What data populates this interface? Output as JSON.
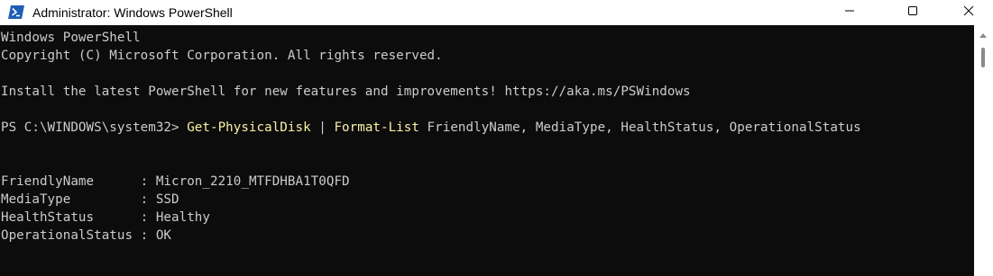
{
  "window": {
    "title": "Administrator: Windows PowerShell",
    "app_icon": "powershell-icon",
    "controls": {
      "minimize_icon": "minimize-icon",
      "maximize_icon": "maximize-icon",
      "close_icon": "close-icon"
    }
  },
  "console": {
    "header_line1": "Windows PowerShell",
    "header_line2": "Copyright (C) Microsoft Corporation. All rights reserved.",
    "install_line": "Install the latest PowerShell for new features and improvements! https://aka.ms/PSWindows",
    "prompt": "PS C:\\WINDOWS\\system32> ",
    "command": {
      "cmdlet1": "Get-PhysicalDisk",
      "pipe": " | ",
      "cmdlet2": "Format-List",
      "args": " FriendlyName, MediaType, HealthStatus, OperationalStatus"
    },
    "output": [
      {
        "key": "FriendlyName      : ",
        "value": "Micron_2210_MTFDHBA1T0QFD"
      },
      {
        "key": "MediaType         : ",
        "value": "SSD"
      },
      {
        "key": "HealthStatus      : ",
        "value": "Healthy"
      },
      {
        "key": "OperationalStatus : ",
        "value": "OK"
      }
    ]
  },
  "colors": {
    "background": "#0c0c0c",
    "text": "#cccccc",
    "command_yellow": "#f9f1a5",
    "titlebar": "#ffffff",
    "icon_blue": "#1f5fb4"
  }
}
